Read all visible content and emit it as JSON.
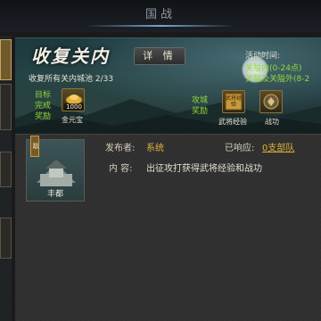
{
  "header": {
    "title": "国战"
  },
  "quest": {
    "title": "收复关内",
    "subtitle": "收复所有关内城池 2/33",
    "detail_button": "详 情"
  },
  "event_time": {
    "label": "活动时间:",
    "line1": "关隘内(0-24点)",
    "line2": "关隘及关隘外(8-2"
  },
  "goal_reward": {
    "label": "目标完成奖励",
    "item_qty": "1000",
    "item_name": "金元宝"
  },
  "attack_reward": {
    "label": "攻城奖励",
    "items": [
      {
        "name": "武将经验",
        "badge": "武将经验"
      },
      {
        "name": "战功"
      }
    ]
  },
  "post": {
    "city_name": "丰都",
    "city_flag": "敌",
    "publisher_label": "发布者:",
    "publisher_value": "系统",
    "response_label": "已响应:",
    "response_value": "0支部队",
    "content_label": "内  容:",
    "content_value": "出征攻打获得武将经验和战功"
  }
}
